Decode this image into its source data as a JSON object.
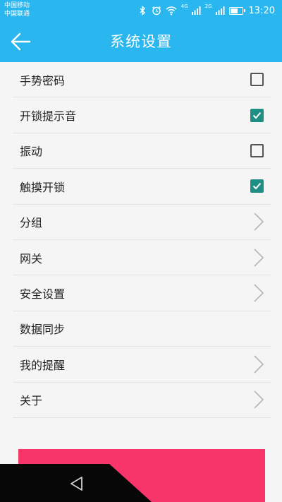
{
  "status_bar": {
    "carrier_1": "中国移动",
    "carrier_2": "中国联通",
    "net_1": "4G",
    "net_2": "2G",
    "battery_level": 0.75,
    "time": "13:20"
  },
  "header": {
    "title": "系统设置",
    "back_icon": "arrow-left-icon"
  },
  "settings": {
    "gesture_password": {
      "label": "手势密码",
      "checked": false
    },
    "unlock_sound": {
      "label": "开锁提示音",
      "checked": true
    },
    "vibration": {
      "label": "振动",
      "checked": false
    },
    "touch_unlock": {
      "label": "触摸开锁",
      "checked": true
    },
    "group": {
      "label": "分组"
    },
    "gateway": {
      "label": "网关"
    },
    "security": {
      "label": "安全设置"
    },
    "data_sync": {
      "label": "数据同步"
    },
    "reminders": {
      "label": "我的提醒"
    },
    "about": {
      "label": "关于"
    }
  },
  "colors": {
    "primary": "#2ab6ee",
    "checkbox_checked": "#1e8f84",
    "bottom_button": "#f7356a",
    "nav_bar": "#070707"
  }
}
